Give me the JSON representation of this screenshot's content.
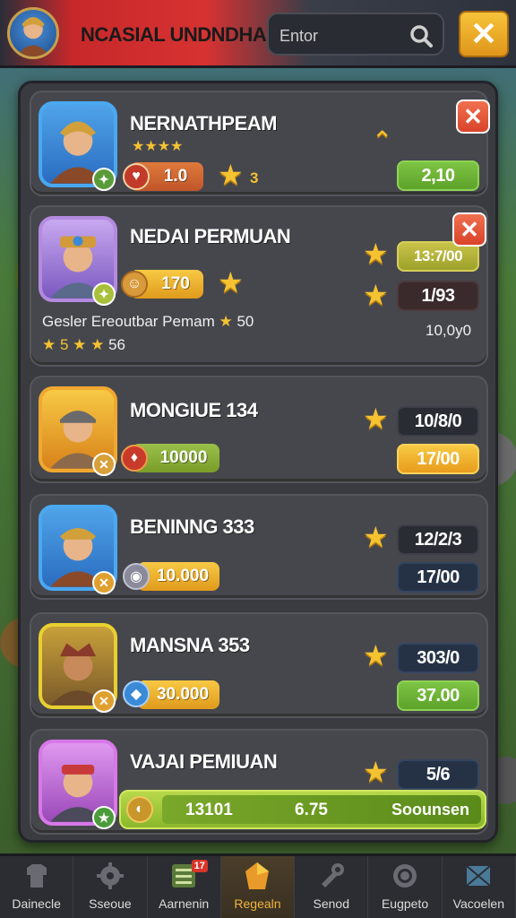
{
  "header": {
    "title": "NCASIAL UNDNDHAN",
    "search_placeholder": "Entor",
    "close_glyph": "✕"
  },
  "players": [
    {
      "name": "NERNATHPEAM",
      "stars": "★★★★",
      "badge_value": "1.0",
      "star_value": "3",
      "stat": "2,10"
    },
    {
      "name": "NEDAI PERMUAN",
      "badge_value": "170",
      "stat_top": "13:7/00",
      "stat_bottom": "1/93",
      "desc": "Gesler Ereoutbar Pemam",
      "desc_value": "50",
      "stars_row": "★ 5 ★ ★",
      "stars_value": "56",
      "extra": "10,0y0"
    },
    {
      "name": "MONGIUE 134",
      "badge_value": "10000",
      "stat_top": "10/8/0",
      "stat_bottom": "17/00"
    },
    {
      "name": "BENINNG 333",
      "badge_value": "10.000",
      "stat_top": "12/2/3",
      "stat_bottom": "17/00"
    },
    {
      "name": "MANSNA 353",
      "badge_value": "30.000",
      "stat_top": "303/0",
      "stat_bottom": "37.00"
    },
    {
      "name": "VAJAI PEMIUAN",
      "stat_top": "5/6",
      "bar_left": "13101",
      "bar_mid": "6.75",
      "bar_right": "Soounsen"
    }
  ],
  "nav": [
    {
      "label": "Dainecle",
      "icon": "shirt-icon"
    },
    {
      "label": "Sseoue",
      "icon": "gear-icon"
    },
    {
      "label": "Aarnenin",
      "icon": "list-icon",
      "badge": "17"
    },
    {
      "label": "Regealn",
      "icon": "gem-icon",
      "active": true
    },
    {
      "label": "Senod",
      "icon": "tools-icon"
    },
    {
      "label": "Eugpeto",
      "icon": "coin-icon"
    },
    {
      "label": "Vacoelen",
      "icon": "map-icon"
    }
  ],
  "colors": {
    "accent_red": "#d63232",
    "gold": "#f5c231",
    "green": "#6cb336",
    "panel": "#3a3b40"
  }
}
